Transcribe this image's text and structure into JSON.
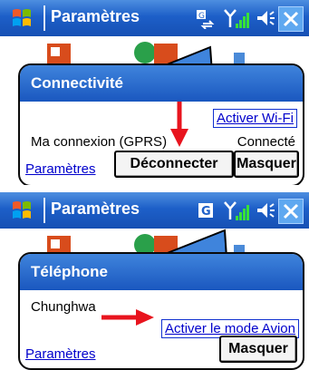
{
  "screen_top": {
    "app_title": "Paramètres",
    "bubble": {
      "header": "Connectivité",
      "wifi_link": "Activer Wi-Fi",
      "connection_name": "Ma connexion (GPRS)",
      "connection_status": "Connecté",
      "settings_link": "Paramètres",
      "disconnect_button": "Déconnecter",
      "hide_button": "Masquer"
    }
  },
  "screen_bottom": {
    "app_title": "Paramètres",
    "bubble": {
      "header": "Téléphone",
      "operator": "Chunghwa",
      "airplane_link": "Activer le mode Avion",
      "settings_link": "Paramètres",
      "hide_button": "Masquer"
    }
  },
  "colors": {
    "titlebar": "#1d5fc8",
    "bubble_header": "#2a6ad0",
    "link": "#0000cc",
    "annotation_arrow": "#e8141e"
  }
}
